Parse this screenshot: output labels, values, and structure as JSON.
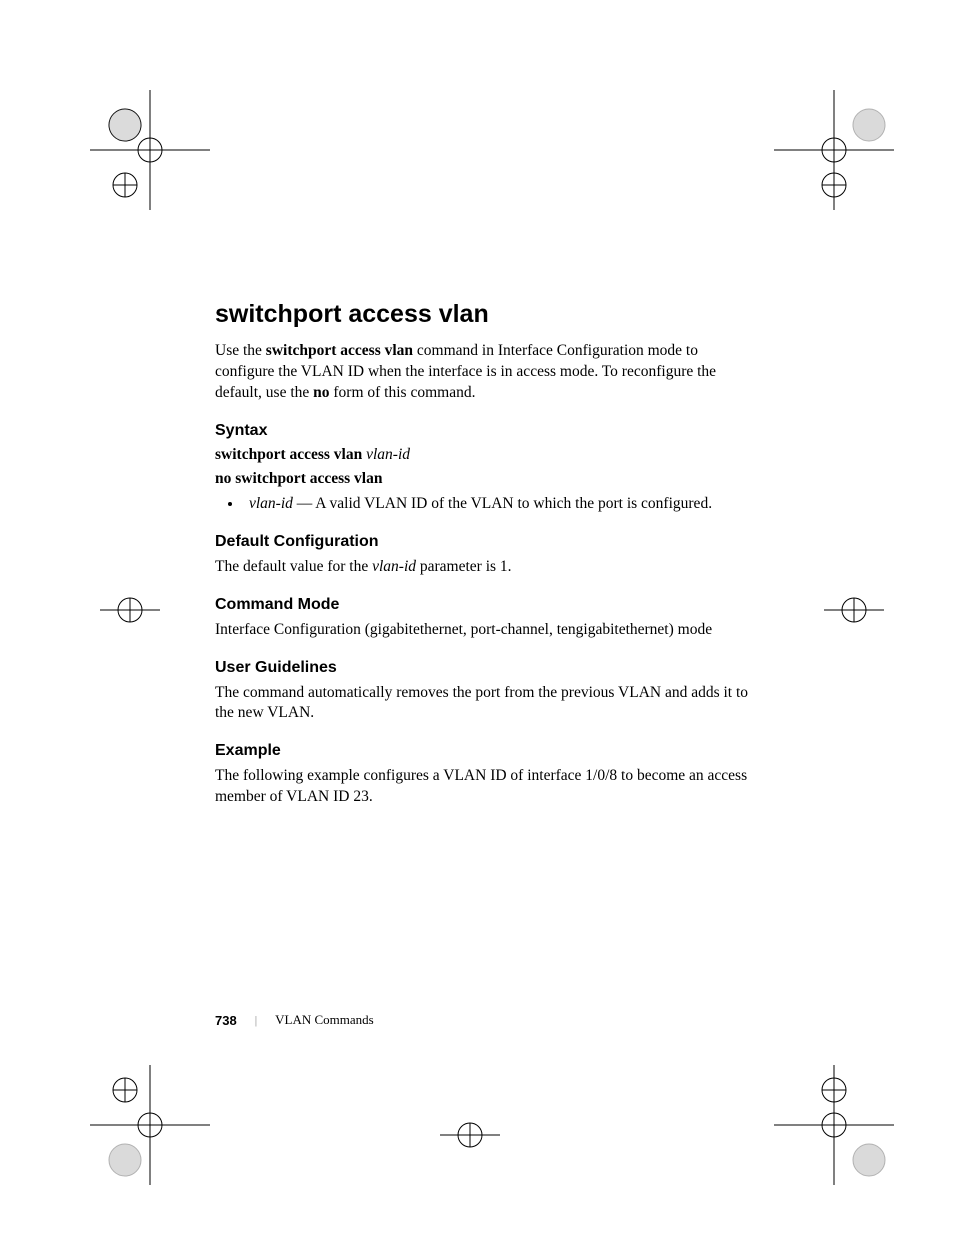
{
  "title": "switchport access vlan",
  "intro": {
    "pre": "Use the ",
    "cmd": "switchport access vlan",
    "post": " command in Interface Configuration mode to configure the VLAN ID when the interface is in access mode. To reconfigure the default, use the ",
    "no": "no",
    "tail": " form of this command."
  },
  "syntax": {
    "heading": "Syntax",
    "line1_cmd": "switchport access vlan",
    "line1_arg": "vlan-id",
    "line2": "no switchport access vlan",
    "bullet_arg": "vlan-id",
    "bullet_text": " — A valid VLAN ID of the VLAN to which the port is configured."
  },
  "default_cfg": {
    "heading": "Default Configuration",
    "pre": "The default value for the ",
    "arg": "vlan-id",
    "post": " parameter is 1."
  },
  "cmd_mode": {
    "heading": "Command Mode",
    "text": "Interface Configuration (gigabitethernet, port-channel, tengigabitethernet) mode"
  },
  "guidelines": {
    "heading": "User Guidelines",
    "text": "The command automatically removes the port from the previous VLAN and adds it to the new VLAN."
  },
  "example": {
    "heading": "Example",
    "text": "The following example configures a VLAN ID of interface 1/0/8 to become an access member of VLAN ID 23."
  },
  "footer": {
    "page": "738",
    "section": "VLAN Commands"
  }
}
